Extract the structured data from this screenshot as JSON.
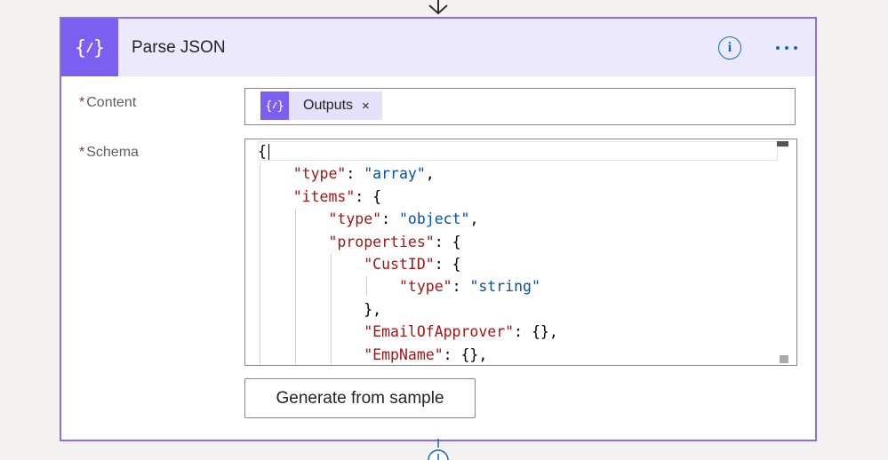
{
  "action": {
    "title": "Parse JSON",
    "icon": "expression-braces-icon"
  },
  "header_actions": {
    "info_glyph": "i",
    "more_glyph": "..."
  },
  "fields": {
    "content": {
      "required_marker": "*",
      "label": "Content",
      "token_label": "Outputs",
      "token_remove": "×"
    },
    "schema": {
      "required_marker": "*",
      "label": "Schema",
      "lines": [
        "{",
        "    \"type\": \"array\",",
        "    \"items\": {",
        "        \"type\": \"object\",",
        "        \"properties\": {",
        "            \"CustID\": {",
        "                \"type\": \"string\"",
        "            },",
        "            \"EmailOfApprover\": {},",
        "            \"EmpName\": {},"
      ]
    }
  },
  "generate_button_label": "Generate from sample",
  "colors": {
    "accent": "#7b5ff0",
    "header_bg": "#ede9fc",
    "border": "#8c6fe8",
    "link_blue": "#0f6cbd",
    "json_key": "#a31515",
    "json_string": "#0451a5"
  }
}
